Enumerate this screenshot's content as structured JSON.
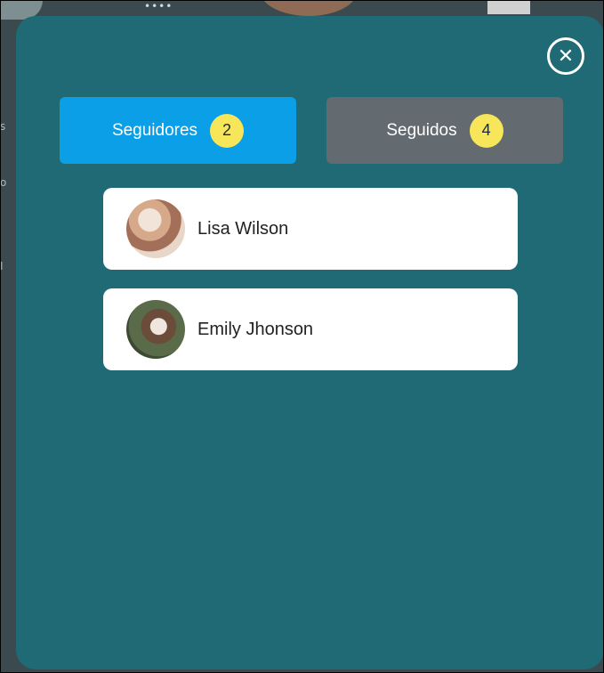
{
  "background": {
    "side_text_1": "s",
    "side_text_2": "o",
    "side_text_3": "I"
  },
  "modal": {
    "close_icon": "close-icon",
    "tabs": [
      {
        "label": "Seguidores",
        "count": "2",
        "active": true,
        "color": "#0a9fe6"
      },
      {
        "label": "Seguidos",
        "count": "4",
        "active": false,
        "color": "#636b70"
      }
    ],
    "badge_color": "#f7e65a",
    "users": [
      {
        "name": "Lisa Wilson"
      },
      {
        "name": "Emily Jhonson"
      }
    ]
  }
}
